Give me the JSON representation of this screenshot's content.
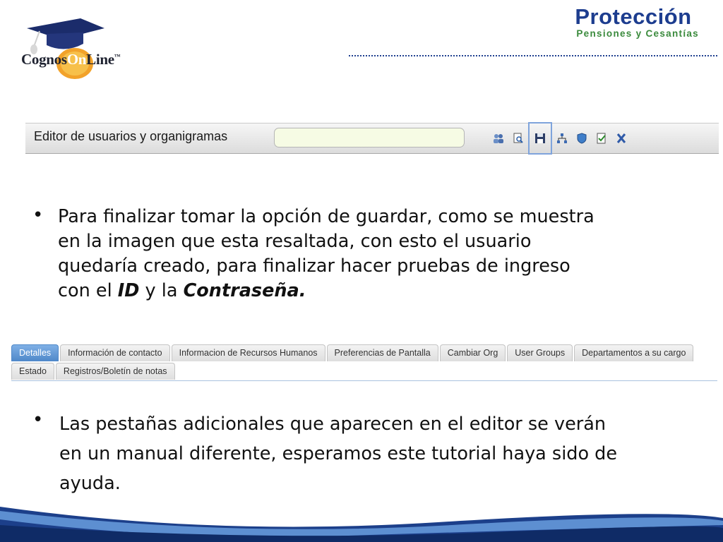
{
  "header": {
    "cognos_logo_text": "CognosOnLine",
    "cognos_logo_parts": {
      "a": "Cognos",
      "b": "On",
      "c": "Line",
      "tm": "™"
    },
    "proteccion_title": "Protección",
    "proteccion_subtitle": "Pensiones y Cesantías"
  },
  "editor": {
    "title": "Editor de usuarios y organigramas",
    "search_value": "",
    "tool_icons": [
      "users-icon",
      "search-document-icon",
      "save-icon",
      "org-chart-icon",
      "shield-icon",
      "checklist-icon",
      "excel-icon"
    ],
    "highlighted_icon": "save-icon"
  },
  "bullets": {
    "first": {
      "lines": [
        "Para finalizar tomar la opción de guardar, como se muestra",
        "en la imagen que esta resaltada, con esto el usuario",
        "quedaría creado, para finalizar hacer pruebas de ingreso"
      ],
      "last_prefix": "con el ",
      "id_word": "ID",
      "middle": " y la ",
      "password_word": "Contraseña."
    },
    "second": {
      "lines": [
        "Las pestañas adicionales que aparecen en el editor se verán",
        "en un manual diferente, esperamos este tutorial haya sido de",
        "ayuda."
      ]
    }
  },
  "tabs": {
    "row1": [
      "Detalles",
      "Información de contacto",
      "Informacion de Recursos Humanos",
      "Preferencias de Pantalla",
      "Cambiar Org",
      "User Groups",
      "Departamentos a su cargo"
    ],
    "row2": [
      "Estado",
      "Registros/Boletín de notas"
    ],
    "active": "Detalles"
  },
  "colors": {
    "proteccion_blue": "#1d3d8f",
    "proteccion_green": "#3a8a3c",
    "active_tab": "#4f88c9",
    "highlight_border": "#7fa4dc"
  }
}
